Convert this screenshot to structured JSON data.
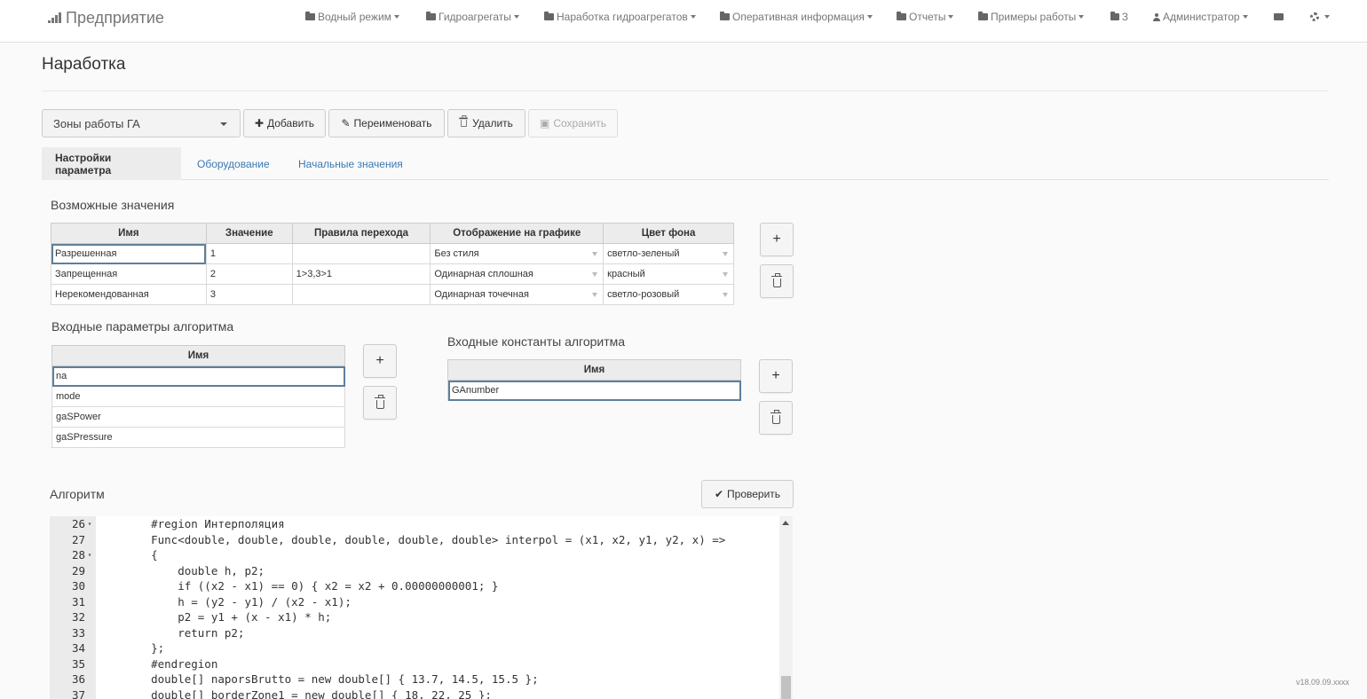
{
  "navbar": {
    "brand": "Предприятие",
    "items": [
      {
        "label": "Водный режим"
      },
      {
        "label": "Гидроагрегаты"
      },
      {
        "label": "Наработка гидроагрегатов"
      },
      {
        "label": "Оперативная информация"
      },
      {
        "label": "Отчеты"
      },
      {
        "label": "Примеры работы"
      },
      {
        "label": "З"
      },
      {
        "label": "Администратор"
      }
    ]
  },
  "page": {
    "title": "Наработка",
    "selector_value": "Зоны работы ГА",
    "buttons": {
      "add": "Добавить",
      "rename": "Переименовать",
      "delete": "Удалить",
      "save": "Сохранить"
    },
    "tabs": [
      "Настройки параметра",
      "Оборудование",
      "Начальные значения"
    ]
  },
  "possible_values": {
    "title": "Возможные значения",
    "headers": [
      "Имя",
      "Значение",
      "Правила перехода",
      "Отображение на графике",
      "Цвет фона"
    ],
    "rows": [
      [
        "Разрешенная",
        "1",
        "",
        "Без стиля",
        "светло-зеленый"
      ],
      [
        "Запрещенная",
        "2",
        "1>3,3>1",
        "Одинарная сплошная",
        "красный"
      ],
      [
        "Нерекомендованная",
        "3",
        "",
        "Одинарная точечная",
        "светло-розовый"
      ]
    ]
  },
  "input_params": {
    "title": "Входные параметры алгоритма",
    "header": "Имя",
    "rows": [
      "na",
      "mode",
      "gaSPower",
      "gaSPressure"
    ]
  },
  "input_consts": {
    "title": "Входные константы алгоритма",
    "header": "Имя",
    "rows": [
      "GAnumber"
    ]
  },
  "algorithm": {
    "title": "Алгоритм",
    "check_button": "Проверить",
    "lines": [
      {
        "n": "26",
        "fold": true
      },
      {
        "n": "27",
        "fold": false
      },
      {
        "n": "28",
        "fold": true
      },
      {
        "n": "29",
        "fold": false
      },
      {
        "n": "30",
        "fold": false
      },
      {
        "n": "31",
        "fold": false
      },
      {
        "n": "32",
        "fold": false
      },
      {
        "n": "33",
        "fold": false
      },
      {
        "n": "34",
        "fold": false
      },
      {
        "n": "35",
        "fold": false
      },
      {
        "n": "36",
        "fold": false
      },
      {
        "n": "37",
        "fold": false
      }
    ],
    "code": [
      "    #region Интерполяция",
      "    Func<double, double, double, double, double, double> interpol = (x1, x2, y1, y2, x) =>",
      "    {",
      "        double h, p2;",
      "        if ((x2 - x1) == 0) { x2 = x2 + 0.00000000001; }",
      "        h = (y2 - y1) / (x2 - x1);",
      "        p2 = y1 + (x - x1) * h;",
      "        return p2;",
      "    };",
      "    #endregion",
      "    double[] naporsBrutto = new double[] { 13.7, 14.5, 15.5 };",
      "    double[] borderZone1 = new double[] { 18, 22, 25 };"
    ]
  },
  "version": "v18.09.09.xxxx"
}
